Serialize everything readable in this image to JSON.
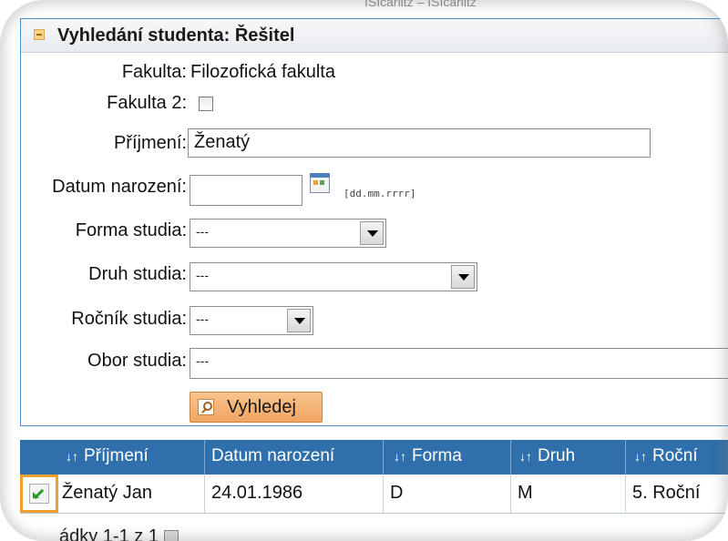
{
  "top_partial_text": "ISIcarlitz – ISIcarlitz",
  "panel": {
    "title": "Vyhledání studenta: Řešitel"
  },
  "form": {
    "fakulta_label": "Fakulta:",
    "fakulta_value": "Filozofická fakulta",
    "fakulta2_label": "Fakulta 2:",
    "fakulta2_checked": false,
    "prijmeni_label": "Příjmení:",
    "prijmeni_value": "Ženatý",
    "datum_label": "Datum narození:",
    "datum_value": "",
    "datum_format_hint": "[dd.mm.rrrr]",
    "forma_label": "Forma studia:",
    "forma_value": "---",
    "druh_label": "Druh studia:",
    "druh_value": "---",
    "rocnik_label": "Ročník studia:",
    "rocnik_value": "---",
    "obor_label": "Obor studia:",
    "obor_value": "---",
    "search_button": "Vyhledej"
  },
  "table": {
    "headers": {
      "prijmeni": "Příjmení",
      "datum": "Datum narození",
      "forma": "Forma",
      "druh": "Druh",
      "rocnik": "Roční"
    },
    "sort_arrows": "↓↑",
    "rows": [
      {
        "name": "Ženatý Jan",
        "datum": "24.01.1986",
        "forma": "D",
        "druh": "M",
        "rocnik": "5. Roční"
      }
    ]
  },
  "pager": {
    "text": "ádky 1-1 z 1"
  },
  "colors": {
    "table_header_bg": "#2f6fab",
    "button_bg": "#f0a563",
    "panel_border": "#4a8fcf",
    "selected_row_border": "#f0a030"
  }
}
